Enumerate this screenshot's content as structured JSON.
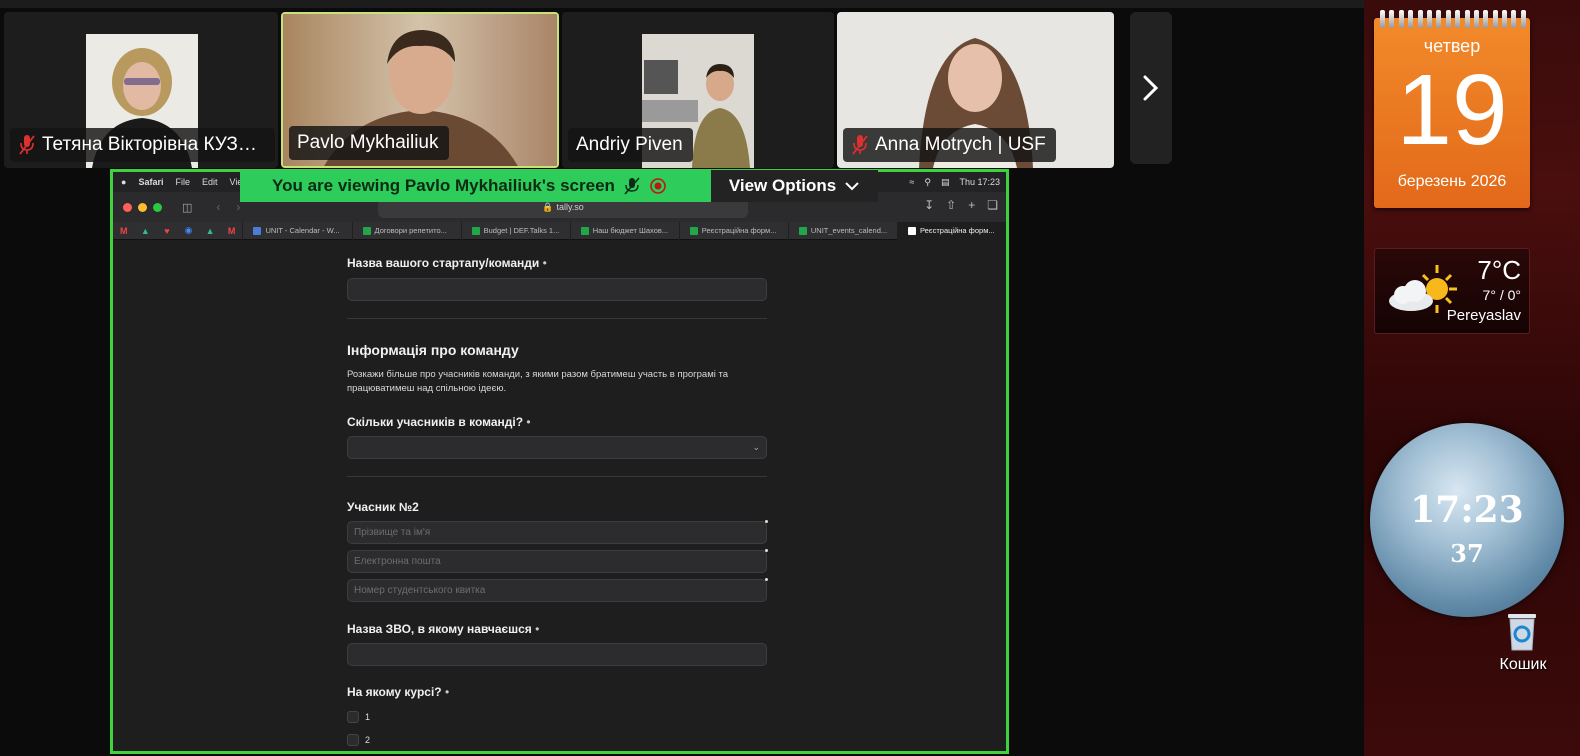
{
  "participants": [
    {
      "name": "Тетяна Вікторівна КУЗН...",
      "muted": true
    },
    {
      "name": "Pavlo Mykhailiuk",
      "muted": false,
      "active": true
    },
    {
      "name": "Andriy Piven",
      "muted": false
    },
    {
      "name": "Anna Motrych | USF",
      "muted": true
    }
  ],
  "banner": {
    "text": "You are viewing  Pavlo Mykhailiuk's screen",
    "view_options": "View Options"
  },
  "mac": {
    "app": "Safari",
    "menu": [
      "File",
      "Edit",
      "View"
    ],
    "clock": "Thu  17:23"
  },
  "browser": {
    "url": "tally.so",
    "tabs": [
      {
        "label": "UNIT - Calendar - W..."
      },
      {
        "label": "Договори репетито..."
      },
      {
        "label": "Budget | DEF.Talks 1..."
      },
      {
        "label": "Наш бюджет Шахов..."
      },
      {
        "label": "Реєстраційна форм..."
      },
      {
        "label": "UNIT_events_calend..."
      },
      {
        "label": "Реєстраційна форм...",
        "current": true
      }
    ]
  },
  "form": {
    "startup_label": "Назва вашого стартапу/команди",
    "team_heading": "Інформація про команду",
    "team_desc_line1": "Розкажи більше про учасників команди, з якими разом братимеш участь в програмі та",
    "team_desc_line2": "працюватимеш над спільною ідеєю.",
    "team_size_label": "Скільки учасників в команді?",
    "member_heading": "Учасник №2",
    "name_placeholder": "Прізвище та ім'я",
    "email_placeholder": "Електронна пошта",
    "student_id_placeholder": "Номер студентського квитка",
    "university_label": "Назва ЗВО, в якому навчаєшся",
    "course_label": "На якому курсі?",
    "course_options": [
      "1",
      "2"
    ],
    "required_mark": "•"
  },
  "desktop": {
    "calendar": {
      "weekday": "четвер",
      "day": "19",
      "month": "березень 2026"
    },
    "weather": {
      "temp": "7°C",
      "range": "7° / 0°",
      "city": "Pereyaslav"
    },
    "clock": {
      "time": "17:23",
      "seconds": "37"
    },
    "recycle_bin": "Кошик"
  },
  "colors": {
    "share_border": "#3fd23f",
    "banner_bg": "#2ecc5a",
    "calendar": "#e97320"
  }
}
